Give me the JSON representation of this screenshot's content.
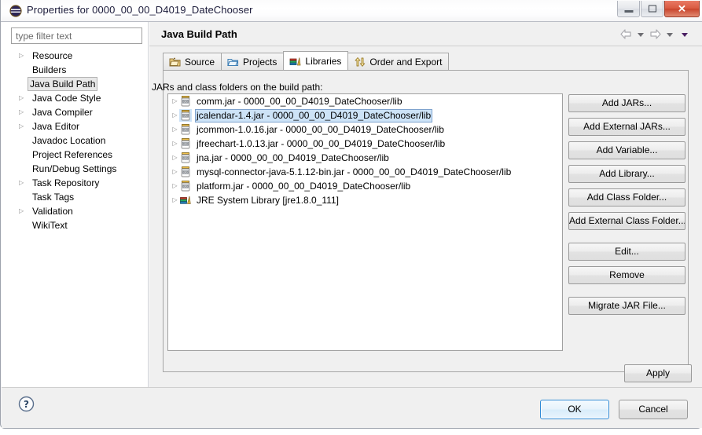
{
  "window": {
    "title": "Properties for 0000_00_00_D4019_DateChooser",
    "app_icon": "eclipse-icon",
    "controls": {
      "minimize": "minimize-button",
      "maximize": "maximize-button",
      "close": "close-button",
      "close_glyph": "✕"
    }
  },
  "sidebar": {
    "filter": {
      "placeholder": "type filter text",
      "value": ""
    },
    "items": [
      {
        "label": "Resource",
        "expandable": true,
        "selected": false
      },
      {
        "label": "Builders",
        "expandable": false,
        "selected": false
      },
      {
        "label": "Java Build Path",
        "expandable": false,
        "selected": true
      },
      {
        "label": "Java Code Style",
        "expandable": true,
        "selected": false
      },
      {
        "label": "Java Compiler",
        "expandable": true,
        "selected": false
      },
      {
        "label": "Java Editor",
        "expandable": true,
        "selected": false
      },
      {
        "label": "Javadoc Location",
        "expandable": false,
        "selected": false
      },
      {
        "label": "Project References",
        "expandable": false,
        "selected": false
      },
      {
        "label": "Run/Debug Settings",
        "expandable": false,
        "selected": false
      },
      {
        "label": "Task Repository",
        "expandable": true,
        "selected": false
      },
      {
        "label": "Task Tags",
        "expandable": false,
        "selected": false
      },
      {
        "label": "Validation",
        "expandable": true,
        "selected": false
      },
      {
        "label": "WikiText",
        "expandable": false,
        "selected": false
      }
    ]
  },
  "main": {
    "page_title": "Java Build Path",
    "nav": {
      "back": "back-arrow-icon",
      "back_menu": "back-dropdown-caret",
      "forward": "forward-arrow-icon",
      "forward_menu": "forward-dropdown-caret",
      "view_menu": "view-menu-caret"
    },
    "tabs": [
      {
        "label": "Source",
        "icon": "source-folder-icon",
        "active": false
      },
      {
        "label": "Projects",
        "icon": "projects-folder-icon",
        "active": false
      },
      {
        "label": "Libraries",
        "icon": "libraries-books-icon",
        "active": true
      },
      {
        "label": "Order and Export",
        "icon": "order-export-arrows-icon",
        "active": false
      }
    ],
    "list_label": "JARs and class folders on the build path:",
    "entries": [
      {
        "label": "comm.jar - 0000_00_00_D4019_DateChooser/lib",
        "icon": "jar-icon",
        "selected": false
      },
      {
        "label": "jcalendar-1.4.jar - 0000_00_00_D4019_DateChooser/lib",
        "icon": "jar-icon",
        "selected": true
      },
      {
        "label": "jcommon-1.0.16.jar - 0000_00_00_D4019_DateChooser/lib",
        "icon": "jar-icon",
        "selected": false
      },
      {
        "label": "jfreechart-1.0.13.jar - 0000_00_00_D4019_DateChooser/lib",
        "icon": "jar-icon",
        "selected": false
      },
      {
        "label": "jna.jar - 0000_00_00_D4019_DateChooser/lib",
        "icon": "jar-icon",
        "selected": false
      },
      {
        "label": "mysql-connector-java-5.1.12-bin.jar - 0000_00_00_D4019_DateChooser/lib",
        "icon": "jar-icon",
        "selected": false
      },
      {
        "label": "platform.jar - 0000_00_00_D4019_DateChooser/lib",
        "icon": "jar-icon",
        "selected": false
      },
      {
        "label": "JRE System Library [jre1.8.0_111]",
        "icon": "jre-library-icon",
        "selected": false
      }
    ],
    "buttons": [
      {
        "label": "Add JARs..."
      },
      {
        "label": "Add External JARs..."
      },
      {
        "label": "Add Variable..."
      },
      {
        "label": "Add Library..."
      },
      {
        "label": "Add Class Folder..."
      },
      {
        "label": "Add External Class Folder..."
      },
      {
        "label": "Edit..."
      },
      {
        "label": "Remove"
      },
      {
        "label": "Migrate JAR File..."
      }
    ],
    "apply_label": "Apply"
  },
  "footer": {
    "help_icon": "help-question-icon",
    "ok_label": "OK",
    "cancel_label": "Cancel"
  },
  "colors": {
    "selection_blue": "#cde3f7",
    "selection_border": "#7da2ce",
    "focus_blue": "#2e8ad6",
    "dialog_bg": "#f0f0f0",
    "close_red": "#d95a41"
  }
}
